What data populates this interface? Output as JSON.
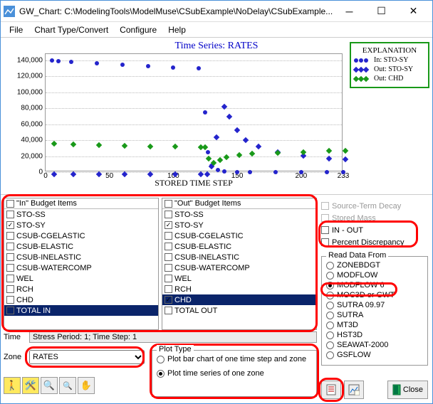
{
  "window": {
    "title": "GW_Chart: C:\\ModelingTools\\ModelMuse\\CSubExample\\NoDelay\\CSubExample...."
  },
  "menu": [
    "File",
    "Chart Type/Convert",
    "Configure",
    "Help"
  ],
  "chart": {
    "title": "Time Series: RATES",
    "xlabel": "STORED TIME STEP",
    "legend_title": "EXPLANATION",
    "legend": [
      "In: STO-SY",
      "Out: STO-SY",
      "Out: CHD"
    ]
  },
  "chart_data": {
    "type": "line",
    "xlabel": "STORED TIME STEP",
    "ylabel": "",
    "xticks": [
      0,
      50,
      100,
      150,
      200,
      233
    ],
    "yticks": [
      0,
      20000,
      40000,
      60000,
      80000,
      100000,
      120000,
      140000
    ],
    "xlim": [
      0,
      233
    ],
    "ylim": [
      0,
      148000
    ],
    "series": [
      {
        "name": "In: STO-SY",
        "color": "#2424cc",
        "marker": "circle",
        "x": [
          5,
          10,
          20,
          40,
          60,
          80,
          100,
          120,
          125,
          127,
          130,
          135,
          140,
          150,
          160,
          180,
          200,
          220,
          233
        ],
        "y": [
          140000,
          139000,
          138000,
          136000,
          134500,
          133000,
          131500,
          130000,
          75000,
          25000,
          8000,
          3000,
          1000,
          0,
          0,
          0,
          0,
          0,
          0
        ]
      },
      {
        "name": "Out: STO-SY",
        "color": "#2424cc",
        "marker": "diamond",
        "x": [
          5,
          20,
          40,
          60,
          80,
          100,
          120,
          125,
          128,
          132,
          138,
          142,
          148,
          155,
          165,
          180,
          200,
          220,
          233
        ],
        "y": [
          0,
          0,
          0,
          0,
          0,
          0,
          0,
          0,
          10000,
          46000,
          85000,
          72000,
          55000,
          43000,
          35000,
          28000,
          23000,
          20000,
          19000
        ]
      },
      {
        "name": "Out: CHD",
        "color": "#199919",
        "marker": "diamond",
        "x": [
          5,
          20,
          40,
          60,
          80,
          100,
          120,
          123,
          126,
          130,
          135,
          140,
          150,
          160,
          180,
          200,
          220,
          233
        ],
        "y": [
          38000,
          37500,
          37000,
          36000,
          35200,
          34500,
          33800,
          33500,
          20000,
          14000,
          18000,
          21000,
          24000,
          25500,
          27000,
          28000,
          29000,
          29500
        ]
      }
    ]
  },
  "in_budget": {
    "header": "\"In\" Budget Items",
    "items": [
      {
        "label": "STO-SS",
        "checked": false
      },
      {
        "label": "STO-SY",
        "checked": true
      },
      {
        "label": "CSUB-CGELASTIC",
        "checked": false
      },
      {
        "label": "CSUB-ELASTIC",
        "checked": false
      },
      {
        "label": "CSUB-INELASTIC",
        "checked": false
      },
      {
        "label": "CSUB-WATERCOMP",
        "checked": false
      },
      {
        "label": "WEL",
        "checked": false
      },
      {
        "label": "RCH",
        "checked": false
      },
      {
        "label": "CHD",
        "checked": false
      },
      {
        "label": "TOTAL IN",
        "checked": false,
        "selected": true
      }
    ]
  },
  "out_budget": {
    "header": "\"Out\" Budget Items",
    "items": [
      {
        "label": "STO-SS",
        "checked": false
      },
      {
        "label": "STO-SY",
        "checked": true
      },
      {
        "label": "CSUB-CGELASTIC",
        "checked": false
      },
      {
        "label": "CSUB-ELASTIC",
        "checked": false
      },
      {
        "label": "CSUB-INELASTIC",
        "checked": false
      },
      {
        "label": "CSUB-WATERCOMP",
        "checked": false
      },
      {
        "label": "WEL",
        "checked": false
      },
      {
        "label": "RCH",
        "checked": false
      },
      {
        "label": "CHD",
        "checked": true,
        "selected": true
      },
      {
        "label": "TOTAL OUT",
        "checked": false
      }
    ]
  },
  "time": {
    "label": "Time",
    "value": "Stress Period: 1; Time Step: 1"
  },
  "zone": {
    "label": "Zone",
    "value": "RATES"
  },
  "plot_type": {
    "title": "Plot Type",
    "bar": "Plot bar chart of one time step and zone",
    "series": "Plot time series of one zone"
  },
  "right_opts": {
    "source_decay": "Source-Term Decay",
    "stored_mass": "Stored Mass",
    "inout": "IN - OUT",
    "pct": "Percent Discrepancy"
  },
  "read_from": {
    "title": "Read Data From",
    "items": [
      "ZONEBDGT",
      "MODFLOW",
      "MODFLOW 6",
      "MOC3D or GWT",
      "SUTRA 09.97",
      "SUTRA",
      "MT3D",
      "HST3D",
      "SEAWAT-2000",
      "GSFLOW"
    ],
    "selected": "MODFLOW 6"
  },
  "close": "Close"
}
